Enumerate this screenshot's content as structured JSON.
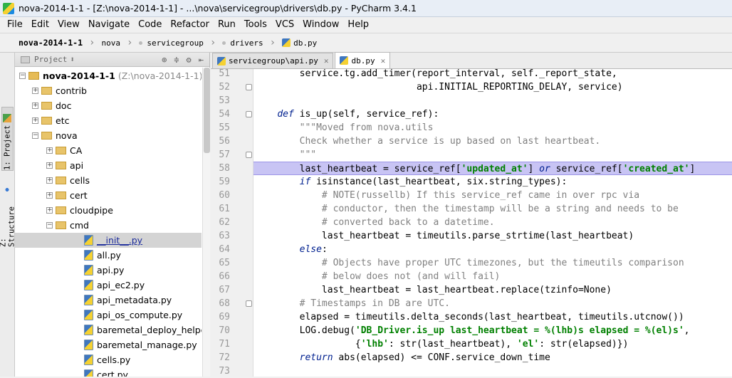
{
  "window": {
    "title": "nova-2014-1-1 - [Z:\\nova-2014-1-1] - ...\\nova\\servicegroup\\drivers\\db.py - PyCharm 3.4.1"
  },
  "menu": [
    "File",
    "Edit",
    "View",
    "Navigate",
    "Code",
    "Refactor",
    "Run",
    "Tools",
    "VCS",
    "Window",
    "Help"
  ],
  "breadcrumb": [
    "nova-2014-1-1",
    "nova",
    "servicegroup",
    "drivers",
    "db.py"
  ],
  "sidebar_tabs": {
    "project": "1: Project",
    "structure": "Z: Structure"
  },
  "project_panel": {
    "header": "Project",
    "tree": [
      {
        "label": "nova-2014-1-1",
        "hint": "(Z:\\nova-2014-1-1)"
      },
      {
        "label": "contrib"
      },
      {
        "label": "doc"
      },
      {
        "label": "etc"
      },
      {
        "label": "nova"
      },
      {
        "label": "CA"
      },
      {
        "label": "api"
      },
      {
        "label": "cells"
      },
      {
        "label": "cert"
      },
      {
        "label": "cloudpipe"
      },
      {
        "label": "cmd"
      },
      {
        "label": "__init__.py"
      },
      {
        "label": "all.py"
      },
      {
        "label": "api.py"
      },
      {
        "label": "api_ec2.py"
      },
      {
        "label": "api_metadata.py"
      },
      {
        "label": "api_os_compute.py"
      },
      {
        "label": "baremetal_deploy_helper.py"
      },
      {
        "label": "baremetal_manage.py"
      },
      {
        "label": "cells.py"
      },
      {
        "label": "cert.py"
      }
    ]
  },
  "editor": {
    "tabs": [
      {
        "label": "servicegroup\\api.py",
        "active": false
      },
      {
        "label": "db.py",
        "active": true
      }
    ],
    "line_numbers": [
      "51",
      "52",
      "53",
      "54",
      "55",
      "56",
      "57",
      "58",
      "59",
      "60",
      "61",
      "62",
      "63",
      "64",
      "65",
      "66",
      "67",
      "68",
      "69",
      "70",
      "71",
      "72",
      "73"
    ],
    "highlight_line": 7
  },
  "colors": {
    "highlight": "#c8c4f4",
    "keyword": "#00208f",
    "string": "#008000",
    "comment": "#808080"
  }
}
